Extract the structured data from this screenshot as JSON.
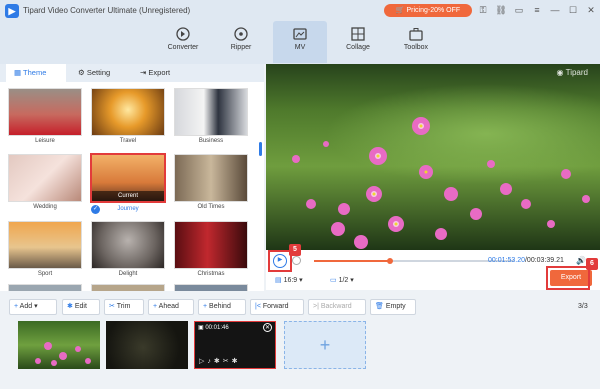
{
  "app": {
    "title": "Tipard Video Converter Ultimate (Unregistered)",
    "promo": "Pricing-20% OFF"
  },
  "nav": [
    {
      "label": "Converter"
    },
    {
      "label": "Ripper"
    },
    {
      "label": "MV"
    },
    {
      "label": "Collage"
    },
    {
      "label": "Toolbox"
    }
  ],
  "tabs": {
    "theme": "Theme",
    "setting": "Setting",
    "export": "Export"
  },
  "themes": {
    "leisure": "Leisure",
    "travel": "Travel",
    "business": "Business",
    "wedding": "Wedding",
    "current": "Current",
    "journey": "Journey",
    "old_times": "Old Times",
    "sport": "Sport",
    "delight": "Delight",
    "christmas": "Christmas"
  },
  "preview": {
    "watermark": "Tipard",
    "time": "00:01:53.20",
    "total": "/00:03:39.21",
    "ratio": "16:9",
    "scale": "1/2",
    "export": "Export",
    "progress": 0.38
  },
  "annotations": {
    "play": "5",
    "export": "6"
  },
  "toolbar": {
    "add": "Add",
    "edit": "Edit",
    "trim": "Trim",
    "ahead": "Ahead",
    "behind": "Behind",
    "forward": "Forward",
    "backward": "Backward",
    "empty": "Empty",
    "count": "3/3"
  },
  "clips": {
    "duration": "00:01:46"
  },
  "colors": {
    "accent": "#2f7be6",
    "promo": "#f0683c",
    "export": "#f0683c",
    "annotation": "#e23b3b"
  }
}
